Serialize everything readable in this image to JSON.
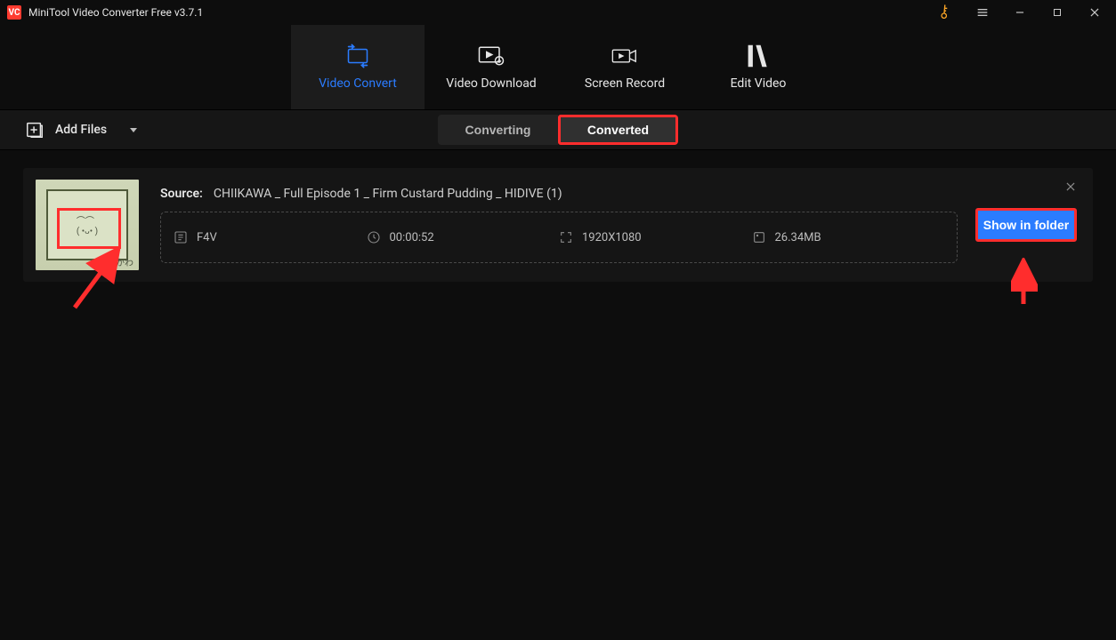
{
  "titlebar": {
    "app_badge": "VC",
    "title": "MiniTool Video Converter Free v3.7.1"
  },
  "nav": {
    "convert": "Video Convert",
    "download": "Video Download",
    "record": "Screen Record",
    "edit": "Edit Video"
  },
  "toolbar": {
    "add_files": "Add Files",
    "converting": "Converting",
    "converted": "Converted"
  },
  "file": {
    "source_label": "Source:",
    "source_name": "CHIIKAWA _ Full Episode 1 _ Firm Custard Pudding _ HIDIVE (1)",
    "format": "F4V",
    "duration": "00:00:52",
    "resolution": "1920X1080",
    "size": "26.34MB",
    "show_in_folder": "Show in folder",
    "thumb_caption": "ちいかわ"
  }
}
